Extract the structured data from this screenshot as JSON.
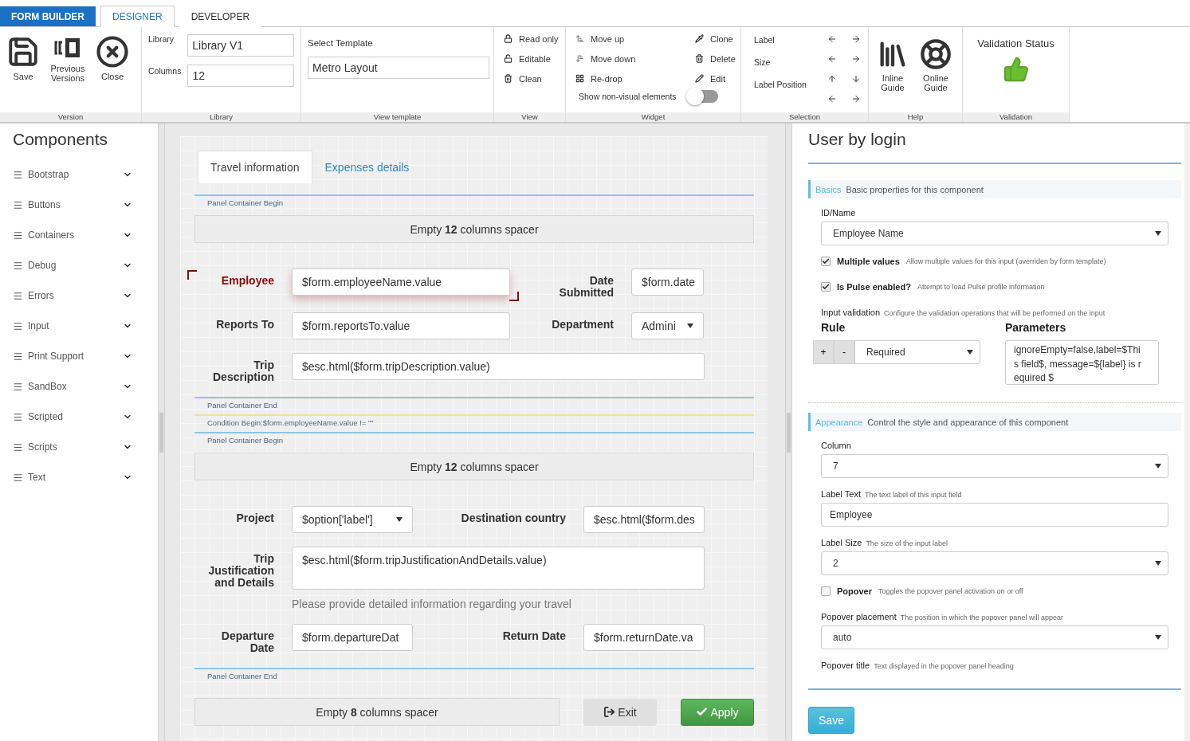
{
  "app_title": "FORM BUILDER",
  "tabs": [
    {
      "label": "DESIGNER",
      "selected": true
    },
    {
      "label": "DEVELOPER",
      "selected": false
    }
  ],
  "ribbon": {
    "version": {
      "caption": "Version",
      "buttons": [
        "Save",
        "Previous Versions",
        "Close"
      ]
    },
    "library": {
      "caption": "Library",
      "fields": [
        {
          "label": "Library",
          "value": "Library V1"
        },
        {
          "label": "Columns",
          "value": "12"
        }
      ]
    },
    "view_template": {
      "caption": "View template",
      "label": "Select Template",
      "value": "Metro Layout"
    },
    "view": {
      "caption": "View",
      "buttons": [
        "Read only",
        "Editable",
        "Clean"
      ]
    },
    "widget": {
      "caption": "Widget",
      "buttons": [
        "Move up",
        "Move down",
        "Re-drop",
        "Clone",
        "Delete",
        "Edit"
      ],
      "toggle": {
        "label": "Show non-visual elements",
        "on": false
      }
    },
    "selection": {
      "caption": "Selection",
      "labels": [
        "Label",
        "Size",
        "Label Position"
      ]
    },
    "help": {
      "caption": "Help",
      "buttons": [
        "Inline Guide",
        "Online Guide"
      ]
    },
    "validation": {
      "caption": "Validation",
      "title": "Validation Status"
    }
  },
  "sidebar": {
    "title": "Components",
    "items": [
      {
        "label": "Bootstrap",
        "expanded": false
      },
      {
        "label": "Buttons",
        "expanded": false
      },
      {
        "label": "Containers",
        "expanded": false
      },
      {
        "label": "Debug",
        "expanded": false
      },
      {
        "label": "Errors",
        "expanded": false
      },
      {
        "label": "Input",
        "expanded": false
      },
      {
        "label": "Print Support",
        "expanded": false
      },
      {
        "label": "SandBox",
        "expanded": false
      },
      {
        "label": "Scripted",
        "expanded": false
      },
      {
        "label": "Scripts",
        "expanded": false
      },
      {
        "label": "Text",
        "expanded": false
      }
    ]
  },
  "canvas": {
    "tabs": [
      {
        "label": "Travel information",
        "selected": true
      },
      {
        "label": "Expenses details",
        "selected": false
      }
    ],
    "blocks": [
      {
        "kind": "marker",
        "text": "Panel Container Begin",
        "color": "#8ec5e6"
      },
      {
        "kind": "spacer",
        "text": "Empty **12** columns spacer"
      },
      {
        "kind": "pair",
        "fields": [
          {
            "label": "Employee",
            "kind": "input",
            "value": "$form.employeeName.value",
            "selected": true
          },
          {
            "label": "Date Submitted",
            "kind": "input",
            "value": "$form.date",
            "selected": false
          }
        ]
      },
      {
        "kind": "pair",
        "fields": [
          {
            "label": "Reports To",
            "kind": "input",
            "value": "$form.reportsTo.value",
            "selected": false
          },
          {
            "label": "Department",
            "kind": "select",
            "value": "Admini",
            "selected": false
          }
        ]
      },
      {
        "kind": "full",
        "fields": [
          {
            "label": "Trip Description",
            "kind": "input",
            "value": "$esc.html($form.tripDescription.value)",
            "selected": false
          }
        ]
      },
      {
        "kind": "marker",
        "text": "Panel Container End",
        "color": "#8ec5e6"
      },
      {
        "kind": "marker",
        "text": "Condition Begin:$form.employeeName.value != \"\"",
        "color": "#f2e08c"
      },
      {
        "kind": "marker",
        "text": "Panel Container Begin",
        "color": "#8ec5e6"
      },
      {
        "kind": "spacer",
        "text": "Empty **12** columns spacer"
      },
      {
        "kind": "split",
        "fields": [
          {
            "label": "Project",
            "kind": "select",
            "value": "$option['label']",
            "selected": false
          },
          {
            "label": "Destination country",
            "kind": "input",
            "value": "$esc.html($form.des",
            "selected": false
          }
        ]
      },
      {
        "kind": "full",
        "fields": [
          {
            "label": "Trip Justification and Details",
            "kind": "textarea",
            "value": "$esc.html($form.tripJustificationAndDetails.value)",
            "help": "Please provide detailed information regarding your travel",
            "selected": false
          }
        ]
      },
      {
        "kind": "split",
        "fields": [
          {
            "label": "Departure Date",
            "kind": "input",
            "value": "$form.departureDat",
            "selected": false
          },
          {
            "label": "Return Date",
            "kind": "input",
            "value": "$form.returnDate.va",
            "selected": false
          }
        ]
      },
      {
        "kind": "marker",
        "text": "Panel Container End",
        "color": "#8ec5e6"
      },
      {
        "kind": "actions",
        "spacer": "Empty **8** columns spacer",
        "buttons": [
          {
            "label": "Exit",
            "kind": "default"
          },
          {
            "label": "Apply",
            "kind": "primary"
          }
        ]
      }
    ]
  },
  "properties": {
    "title": "User by login",
    "sections": [
      {
        "title": "Basics",
        "description": "Basic properties for this component",
        "items": [
          {
            "kind": "select",
            "label": "ID/Name",
            "value": "Employee Name"
          },
          {
            "kind": "checkbox",
            "label": "Multiple values",
            "hint": "Allow multiple values for this input (overriden by form template)",
            "checked": true
          },
          {
            "kind": "checkbox",
            "label": "Is Pulse enabled?",
            "hint": "Attempt to load Pulse profile information",
            "checked": true
          },
          {
            "kind": "validation",
            "label": "Input validation",
            "hint": "Configure the validation operations that will be performed on the input",
            "rule_heading": "Rule",
            "params_heading": "Parameters",
            "buttons": [
              "+",
              "-"
            ],
            "rule": "Required",
            "params": "ignoreEmpty=false,label=$This field$, message=${label} is required $"
          }
        ]
      },
      {
        "title": "Appearance",
        "description": "Control the style and appearance of this component",
        "items": [
          {
            "kind": "select",
            "label": "Column",
            "value": "7"
          },
          {
            "kind": "input",
            "label": "Label Text",
            "hint": "The text label of this input field",
            "value": "Employee"
          },
          {
            "kind": "select",
            "label": "Label Size",
            "hint": "The size of the input label",
            "value": "2"
          },
          {
            "kind": "checkbox",
            "label": "Popover",
            "hint": "Toggles the popover panel activation on or off",
            "checked": false
          },
          {
            "kind": "select",
            "label": "Popover placement",
            "hint": "The position in which the popover panel will appear",
            "value": "auto"
          },
          {
            "kind": "label",
            "label": "Popover title",
            "hint": "Text displayed in the popover panel heading"
          }
        ]
      }
    ],
    "save": "Save"
  }
}
